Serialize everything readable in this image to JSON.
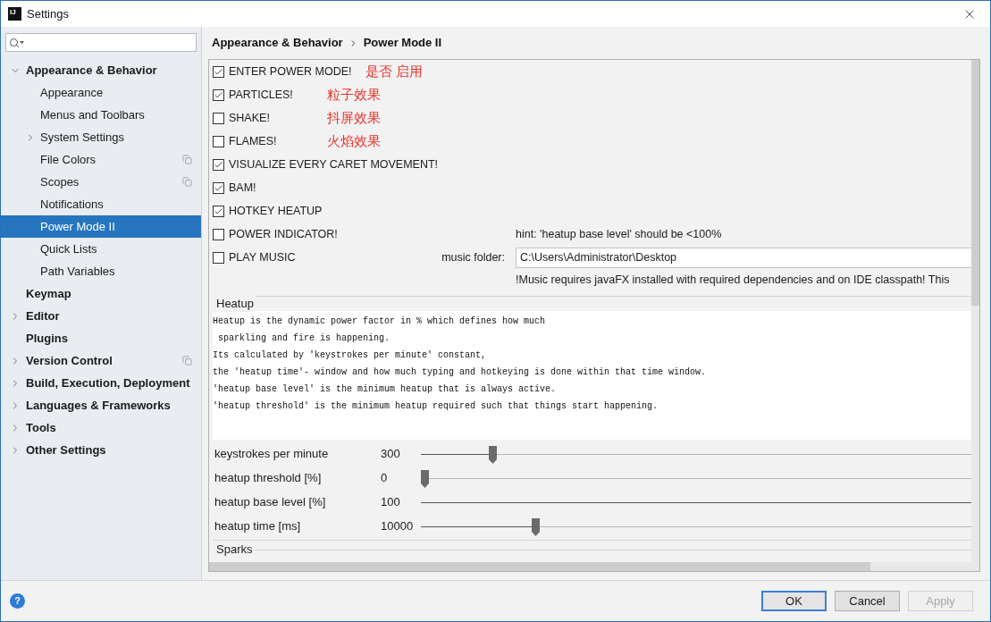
{
  "window": {
    "title": "Settings",
    "logo_text": "IJ"
  },
  "sidebar": {
    "items": [
      {
        "label": "Appearance & Behavior",
        "expandable": true,
        "expanded": true,
        "selected": false,
        "copy_icon": false,
        "children": [
          {
            "label": "Appearance",
            "expandable": false,
            "selected": false,
            "copy_icon": false
          },
          {
            "label": "Menus and Toolbars",
            "expandable": false,
            "selected": false,
            "copy_icon": false
          },
          {
            "label": "System Settings",
            "expandable": true,
            "expanded": false,
            "selected": false,
            "copy_icon": false
          },
          {
            "label": "File Colors",
            "expandable": false,
            "selected": false,
            "copy_icon": true
          },
          {
            "label": "Scopes",
            "expandable": false,
            "selected": false,
            "copy_icon": true
          },
          {
            "label": "Notifications",
            "expandable": false,
            "selected": false,
            "copy_icon": false
          },
          {
            "label": "Power Mode II",
            "expandable": false,
            "selected": true,
            "copy_icon": false
          },
          {
            "label": "Quick Lists",
            "expandable": false,
            "selected": false,
            "copy_icon": false
          },
          {
            "label": "Path Variables",
            "expandable": false,
            "selected": false,
            "copy_icon": false
          }
        ]
      },
      {
        "label": "Keymap",
        "expandable": false,
        "selected": false,
        "copy_icon": false
      },
      {
        "label": "Editor",
        "expandable": true,
        "expanded": false,
        "selected": false,
        "copy_icon": false
      },
      {
        "label": "Plugins",
        "expandable": false,
        "selected": false,
        "copy_icon": false
      },
      {
        "label": "Version Control",
        "expandable": true,
        "expanded": false,
        "selected": false,
        "copy_icon": true
      },
      {
        "label": "Build, Execution, Deployment",
        "expandable": true,
        "expanded": false,
        "selected": false,
        "copy_icon": false
      },
      {
        "label": "Languages & Frameworks",
        "expandable": true,
        "expanded": false,
        "selected": false,
        "copy_icon": false
      },
      {
        "label": "Tools",
        "expandable": true,
        "expanded": false,
        "selected": false,
        "copy_icon": false
      },
      {
        "label": "Other Settings",
        "expandable": true,
        "expanded": false,
        "selected": false,
        "copy_icon": false
      }
    ]
  },
  "breadcrumb": [
    "Appearance & Behavior",
    "Power Mode II"
  ],
  "options": [
    {
      "label": "ENTER POWER MODE!",
      "checked": true,
      "annotation": "是否 启用"
    },
    {
      "label": "PARTICLES!",
      "checked": true,
      "annotation": "粒子效果"
    },
    {
      "label": "SHAKE!",
      "checked": false,
      "annotation": "抖屏效果"
    },
    {
      "label": "FLAMES!",
      "checked": false,
      "annotation": "火焰效果"
    },
    {
      "label": "VISUALIZE EVERY CARET MOVEMENT!",
      "checked": true
    },
    {
      "label": "BAM!",
      "checked": true
    },
    {
      "label": "HOTKEY HEATUP",
      "checked": true
    },
    {
      "label": "POWER INDICATOR!",
      "checked": false,
      "hint": "hint: 'heatup base level' should be <100%"
    },
    {
      "label": "PLAY MUSIC",
      "checked": false,
      "folder": {
        "label": "music folder:",
        "value": "C:\\Users\\Administrator\\Desktop"
      }
    }
  ],
  "music_note": "!Music requires javaFX installed with required dependencies and on IDE classpath! This",
  "heatup": {
    "title": "Heatup",
    "description": [
      "Heatup is the dynamic power factor in % which defines how much",
      " sparkling and fire is happening.",
      "Its calculated by 'keystrokes per minute' constant,",
      "the 'heatup time'- window and how much typing and hotkeying is done within that time window.",
      "'heatup base level' is the minimum heatup that is always active.",
      "'heatup threshold' is the minimum heatup required such that things start happening."
    ],
    "sliders": [
      {
        "label": "keystrokes per minute",
        "reading": "300",
        "level": 0.126
      },
      {
        "label": "heatup threshold [%]",
        "reading": "0",
        "level": 0
      },
      {
        "label": "heatup base level [%]",
        "reading": "100",
        "level": 1
      },
      {
        "label": "heatup time [ms]",
        "reading": "10000",
        "level": 0.204
      }
    ]
  },
  "sparks": {
    "title": "Sparks"
  },
  "help": "?",
  "buttons": [
    {
      "label": "OK",
      "kind": "default"
    },
    {
      "label": "Cancel",
      "kind": "normal"
    },
    {
      "label": "Apply",
      "kind": "disabled"
    }
  ]
}
